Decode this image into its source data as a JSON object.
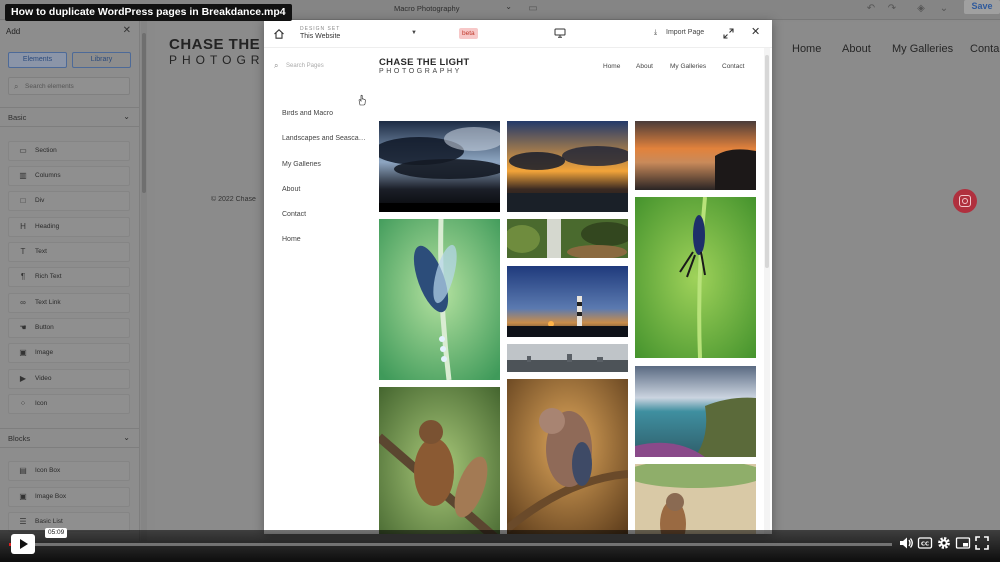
{
  "video": {
    "title": "How to duplicate WordPress pages in Breakdance.mp4",
    "timestamp": "05:09",
    "progress_fraction": 0.022
  },
  "builder": {
    "document_select": "Macro Photography",
    "save_label": "Save",
    "left_panel": {
      "title": "Add",
      "tabs": [
        "Elements",
        "Library"
      ],
      "search_placeholder": "Search elements",
      "sections": [
        {
          "label": "Basic",
          "items": [
            "Section",
            "Columns",
            "Div",
            "Heading",
            "Text",
            "Rich Text",
            "Text Link",
            "Button",
            "Image",
            "Video",
            "Icon"
          ]
        },
        {
          "label": "Blocks",
          "items": [
            "Icon Box",
            "Image Box",
            "Basic List"
          ]
        }
      ]
    },
    "background_page": {
      "logo_line1": "CHASE THE LI",
      "logo_line2": "PHOTOGRA",
      "nav": [
        "Home",
        "About",
        "My Galleries",
        "Conta"
      ],
      "footer": "© 2022 Chase"
    }
  },
  "modal": {
    "design_set_label": "DESIGN SET",
    "design_set_value": "This Website",
    "beta_label": "beta",
    "import_label": "Import Page",
    "search_placeholder": "Search Pages",
    "pages": [
      "Birds and Macro",
      "Landscapes and Seascapes",
      "My Galleries",
      "About",
      "Contact",
      "Home"
    ],
    "preview": {
      "logo_line1": "CHASE THE LIGHT",
      "logo_line2": "PHOTOGRAPHY",
      "nav": [
        "Home",
        "About",
        "My Galleries",
        "Contact"
      ]
    }
  },
  "icons": {
    "home": "home-icon",
    "monitor": "monitor-icon",
    "import": "download-icon",
    "expand": "expand-icon",
    "close": "close-icon",
    "search": "search-icon",
    "instagram": "instagram-icon",
    "play": "play-icon",
    "volume": "volume-icon",
    "captions": "cc-icon",
    "settings": "gear-icon",
    "miniplayer": "miniplayer-icon",
    "fullscreen": "fullscreen-icon"
  }
}
